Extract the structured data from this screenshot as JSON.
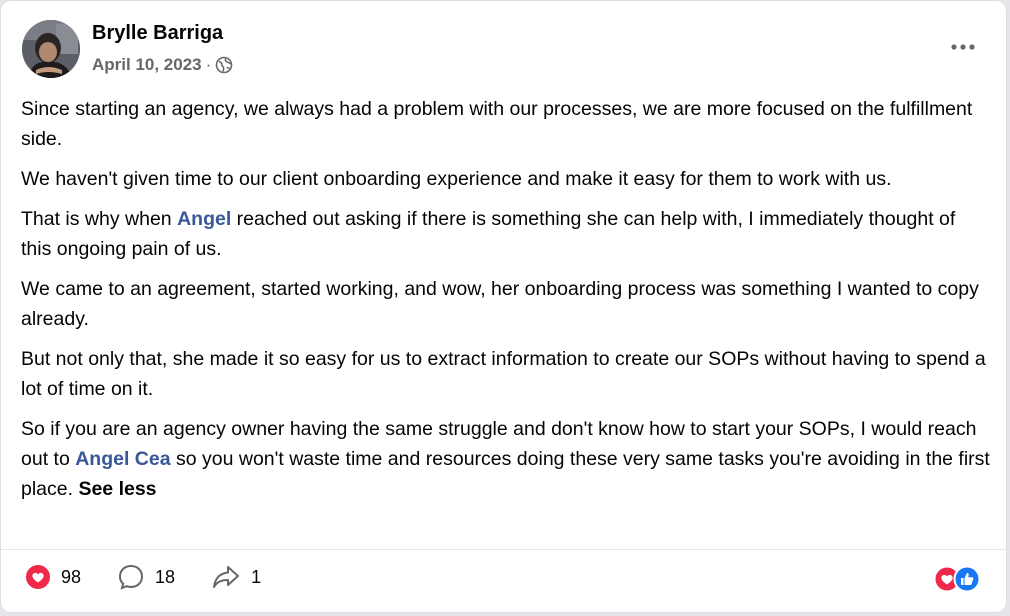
{
  "post": {
    "author": "Brylle Barriga",
    "date": "April 10, 2023",
    "separator": "·",
    "audience_icon": "globe-icon",
    "mentions": {
      "angel": "Angel",
      "angel_cea": "Angel Cea"
    },
    "paragraphs": {
      "p1": "Since starting an agency, we always had a problem with our processes, we are more focused on the fulfillment side.",
      "p2": "We haven't given time to our client onboarding experience and make it easy for them to work with us.",
      "p3_before": "That is why when ",
      "p3_after": " reached out asking if there is something she can help with, I immediately thought of this ongoing pain of us.",
      "p4": "We came to an agreement, started working, and wow, her onboarding process was something I wanted to copy already.",
      "p5": "But not only that, she made it so easy for us to extract information to create our SOPs without having to spend a lot of time on it.",
      "p6_before": "So if you are an agency owner having the same struggle and don't know how to start your SOPs, I would reach out to ",
      "p6_after": " so you won't waste time and resources doing these very same tasks you're avoiding in the first place. "
    },
    "see_less": "See less"
  },
  "stats": {
    "likes": "98",
    "comments": "18",
    "shares": "1"
  },
  "colors": {
    "heart": "#f0284a",
    "like_blue": "#1877f2",
    "mention": "#385898",
    "secondary_text": "#65676b"
  }
}
